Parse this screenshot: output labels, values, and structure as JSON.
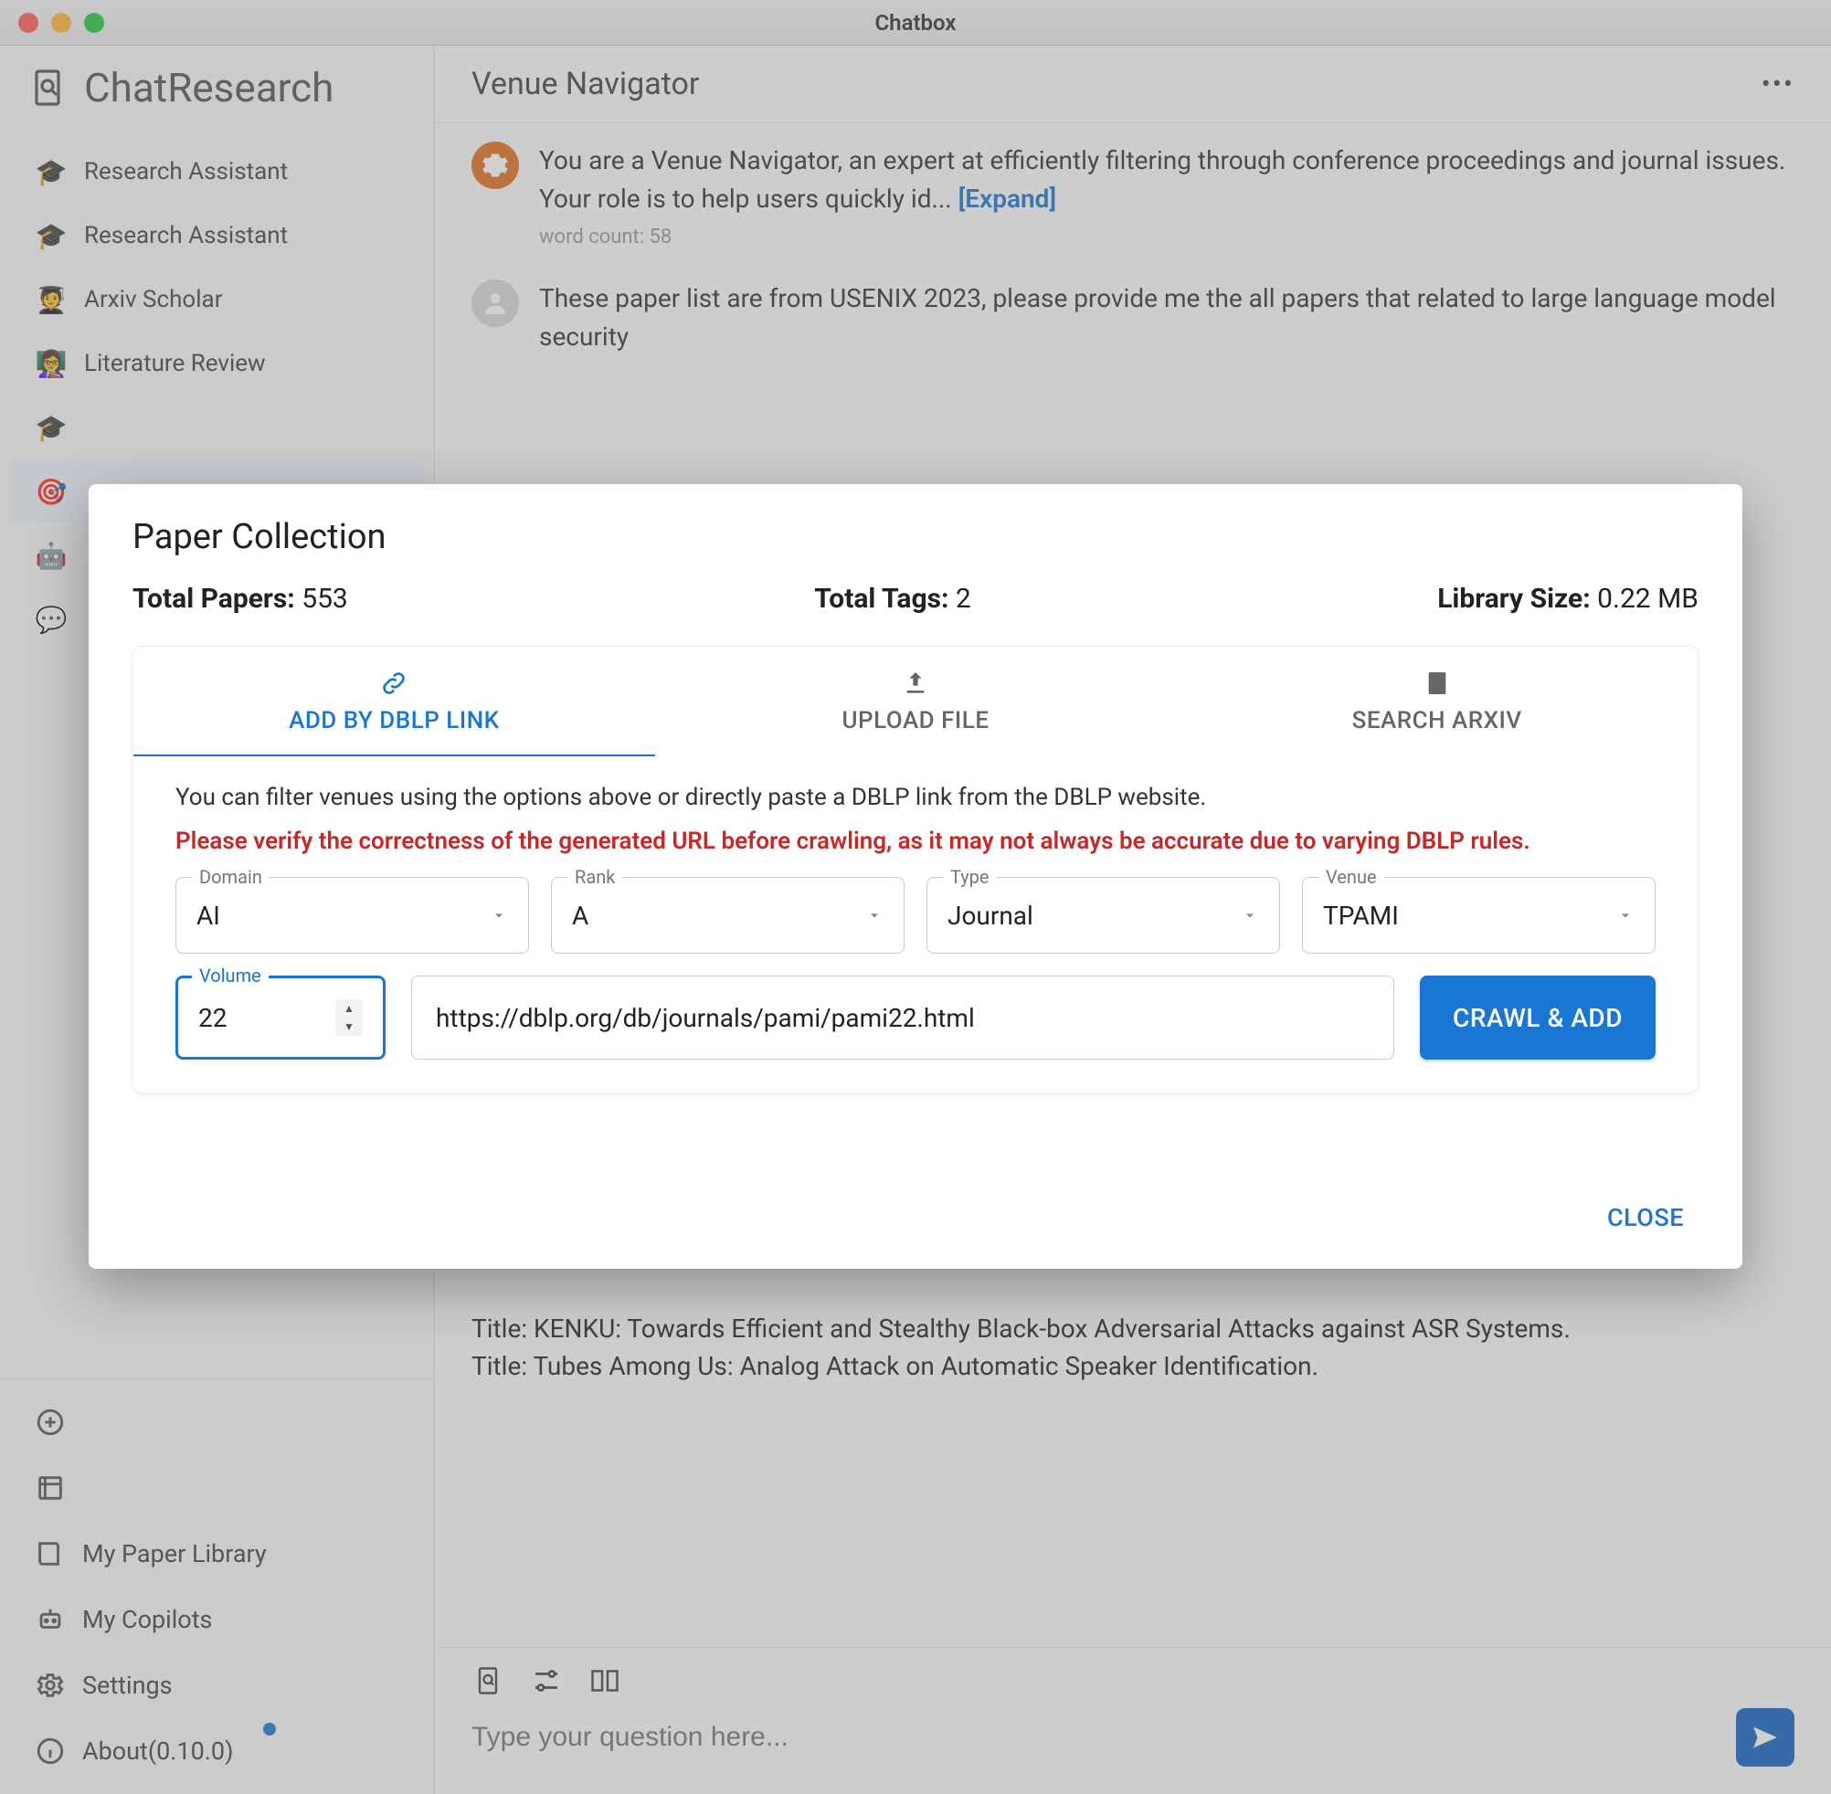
{
  "window": {
    "title": "Chatbox"
  },
  "brand": {
    "name": "ChatResearch"
  },
  "sidebar": {
    "items": [
      {
        "label": "Research Assistant",
        "icon": "🎓"
      },
      {
        "label": "Research Assistant",
        "icon": "🎓"
      },
      {
        "label": "Arxiv Scholar",
        "icon": "🧑‍🎓"
      },
      {
        "label": "Literature Review",
        "icon": "👩‍🏫"
      },
      {
        "label": "",
        "icon": "🎓"
      },
      {
        "label": "",
        "icon": "🎯",
        "active": true
      },
      {
        "label": "",
        "icon": "🤖"
      },
      {
        "label": "",
        "icon": "💬"
      }
    ],
    "bottom": {
      "newItem": "",
      "p2": "",
      "library": "My Paper Library",
      "copilots": "My Copilots",
      "settings": "Settings",
      "about": "About(0.10.0)"
    }
  },
  "header": {
    "title": "Venue Navigator"
  },
  "messages": {
    "system": {
      "text": "You are a Venue Navigator, an expert at efficiently filtering through conference proceedings and journal issues. Your role is to help users quickly id... ",
      "expand": "[Expand]",
      "wc": "word count: 58"
    },
    "user": {
      "text": "These paper list are from USENIX 2023, please provide me the all papers that related to large language model security"
    },
    "titles": [
      "Title: KENKU: Towards Efficient and Stealthy Black-box Adversarial Attacks against ASR Systems.",
      "Title: Tubes Among Us: Analog Attack on Automatic Speaker Identification."
    ]
  },
  "input": {
    "placeholder": "Type your question here..."
  },
  "modal": {
    "title": "Paper Collection",
    "stats": {
      "tpLabel": "Total Papers: ",
      "tpVal": "553",
      "ttLabel": "Total Tags: ",
      "ttVal": "2",
      "lsLabel": "Library Size: ",
      "lsVal": "0.22 MB"
    },
    "tabs": {
      "dblp": "ADD BY DBLP LINK",
      "upload": "UPLOAD FILE",
      "arxiv": "SEARCH ARXIV"
    },
    "helper": "You can filter venues using the options above or directly paste a DBLP link from the DBLP website.",
    "warn": "Please verify the correctness of the generated URL before crawling, as it may not always be accurate due to varying DBLP rules.",
    "fields": {
      "domain": {
        "label": "Domain",
        "value": "AI"
      },
      "rank": {
        "label": "Rank",
        "value": "A"
      },
      "type": {
        "label": "Type",
        "value": "Journal"
      },
      "venue": {
        "label": "Venue",
        "value": "TPAMI"
      },
      "volume": {
        "label": "Volume",
        "value": "22"
      },
      "url": "https://dblp.org/db/journals/pami/pami22.html"
    },
    "crawlBtn": "CRAWL & ADD",
    "closeBtn": "CLOSE"
  }
}
